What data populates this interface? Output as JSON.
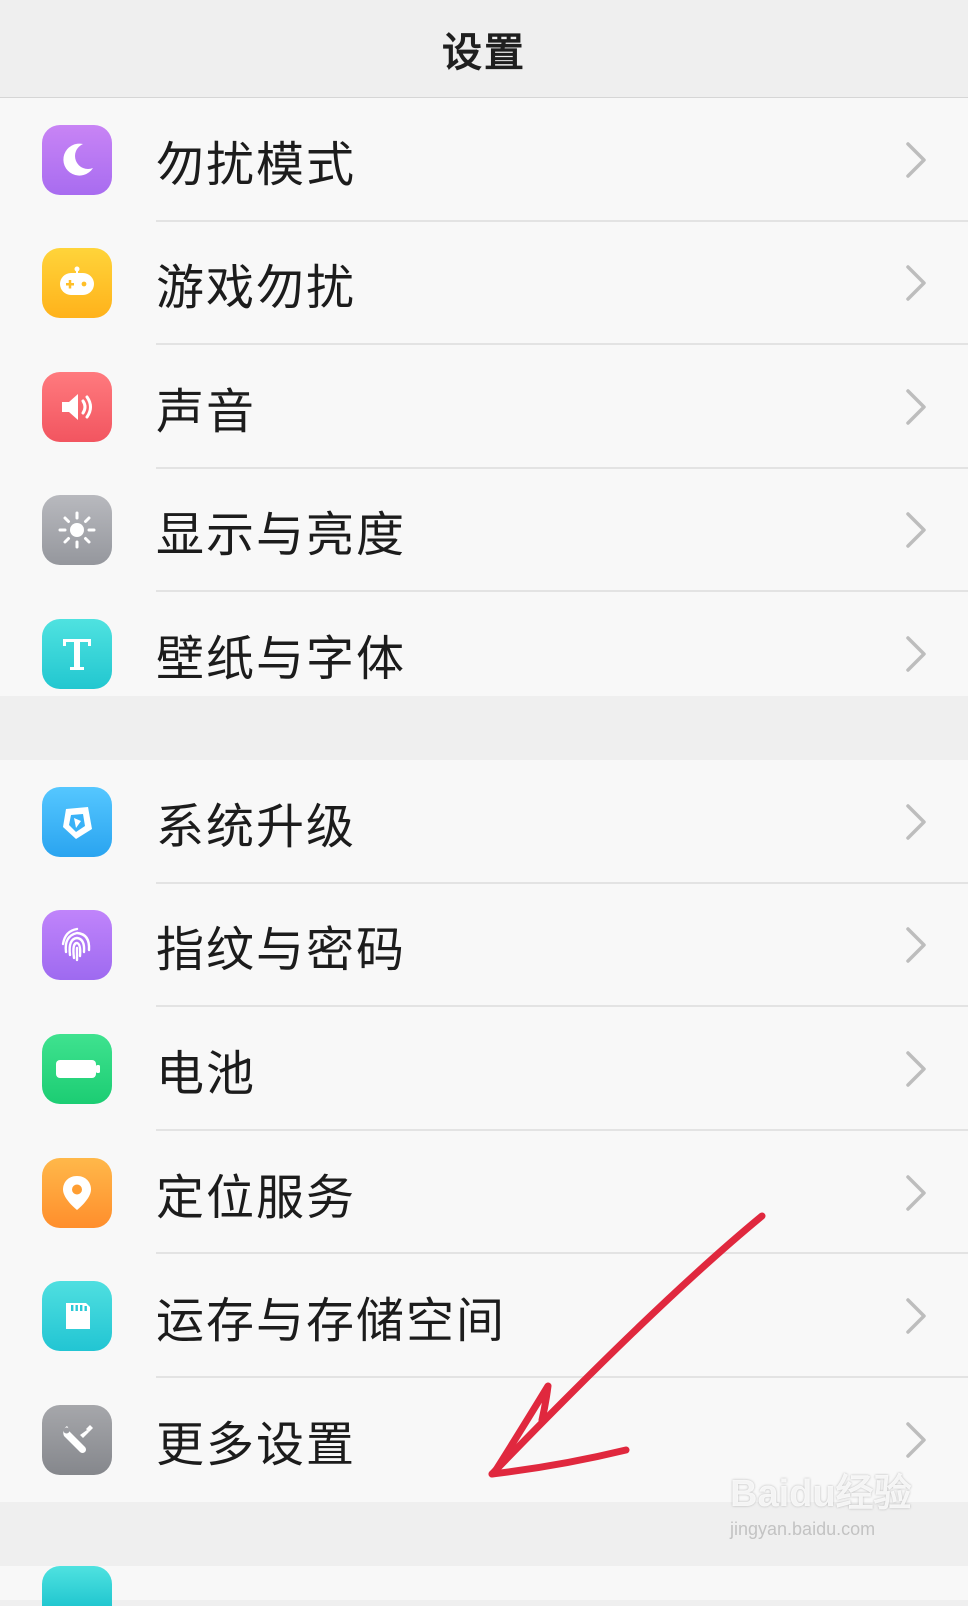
{
  "header": {
    "title": "设置"
  },
  "groups": [
    {
      "items": [
        {
          "label": "勿扰模式",
          "icon": "moon-icon"
        },
        {
          "label": "游戏勿扰",
          "icon": "gamepad-icon"
        },
        {
          "label": "声音",
          "icon": "speaker-icon"
        },
        {
          "label": "显示与亮度",
          "icon": "sun-icon"
        },
        {
          "label": "壁纸与字体",
          "icon": "letter-t-icon"
        }
      ]
    },
    {
      "items": [
        {
          "label": "系统升级",
          "icon": "upgrade-icon"
        },
        {
          "label": "指纹与密码",
          "icon": "fingerprint-icon"
        },
        {
          "label": "电池",
          "icon": "battery-icon"
        },
        {
          "label": "定位服务",
          "icon": "location-pin-icon"
        },
        {
          "label": "运存与存储空间",
          "icon": "sd-card-icon"
        },
        {
          "label": "更多设置",
          "icon": "wrench-icon"
        }
      ]
    }
  ],
  "colors": {
    "background": "#efefef",
    "list_background": "#f8f8f8",
    "annotation_arrow": "#e0283e"
  },
  "watermark": {
    "logo": "Baidu经验",
    "url": "jingyan.baidu.com"
  }
}
